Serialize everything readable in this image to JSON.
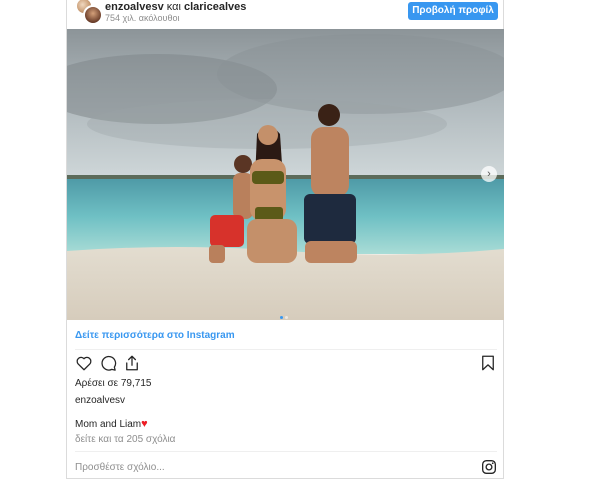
{
  "post": {
    "header": {
      "account": "enzoalvesv",
      "connector": " και ",
      "coaccount": "claricealves",
      "followers": "754 χιλ. ακόλουθοι",
      "profile_button": "Προβολή προφίλ"
    },
    "carousel": {
      "current_slide": 1,
      "total_slides": 2
    },
    "more_link": "Δείτε περισσότερα στο Instagram",
    "likes_text": "Αρέσει σε 79,715",
    "owner": "enzoalvesv",
    "caption": "Mom and Liam",
    "view_comments": "δείτε και τα 205 σχόλια",
    "comment_placeholder": "Προσθέστε σχόλιο...",
    "icons": [
      "like-heart-icon",
      "comment-icon",
      "share-icon",
      "bookmark-icon",
      "instagram-icon",
      "next-arrow-icon"
    ],
    "colors": {
      "accent": "#3897f0",
      "heart_emoji": "#ed1c24"
    }
  }
}
